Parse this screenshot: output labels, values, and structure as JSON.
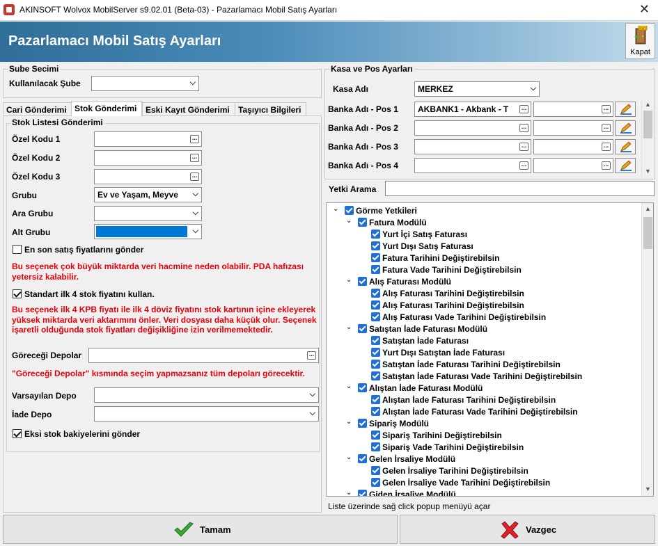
{
  "window": {
    "title": "AKINSOFT Wolvox MobilServer s9.02.01 (Beta-03) - Pazarlamacı Mobil Satış Ayarları",
    "close_glyph": "✕"
  },
  "banner": {
    "title": "Pazarlamacı Mobil Satış Ayarları",
    "exit_label": "Kapat",
    "exit_icon_text": "EXIT"
  },
  "sube": {
    "caption": "Sube Secimi",
    "label": "Kullanılacak Şube",
    "value": ""
  },
  "tabs": [
    {
      "label": "Cari Gönderimi",
      "active": false
    },
    {
      "label": "Stok Gönderimi",
      "active": true
    },
    {
      "label": "Eski Kayıt Gönderimi",
      "active": false
    },
    {
      "label": "Taşıyıcı Bilgileri",
      "active": false
    }
  ],
  "stok": {
    "caption": "Stok Listesi Gönderimi",
    "ozel_kodu_1": {
      "label": "Özel Kodu 1",
      "value": ""
    },
    "ozel_kodu_2": {
      "label": "Özel Kodu 2",
      "value": ""
    },
    "ozel_kodu_3": {
      "label": "Özel Kodu 3",
      "value": ""
    },
    "grubu": {
      "label": "Grubu",
      "value": "Ev ve Yaşam, Meyve"
    },
    "ara_grubu": {
      "label": "Ara Grubu",
      "value": ""
    },
    "alt_grubu": {
      "label": "Alt Grubu",
      "value": "",
      "selected_color": "#0078d7"
    },
    "chk_son_satis": {
      "label": "En son satış fiyatlarını gönder",
      "checked": false
    },
    "warn_1": "Bu seçenek çok büyük miktarda veri hacmine neden olabilir. PDA hafızası yetersiz kalabilir.",
    "chk_standart": {
      "label": "Standart ilk 4 stok fiyatını kullan.",
      "checked": true
    },
    "warn_2": "Bu seçenek ilk 4 KPB fiyatı ile ilk 4 döviz fiyatını stok kartının içine ekleyerek yüksek miktarda veri aktarımını önler. Veri dosyası daha küçük olur. Seçenek işaretli olduğunda stok fiyatları değişikliğine izin verilmemektedir.",
    "gorecegi_depolar": {
      "label": "Göreceği Depolar",
      "value": ""
    },
    "warn_3": "\"Göreceği Depolar\" kısmında seçim yapmazsanız tüm depoları görecektir.",
    "varsayilan_depo": {
      "label": "Varsayılan Depo",
      "value": ""
    },
    "iade_depo": {
      "label": "İade Depo",
      "value": ""
    },
    "chk_eksi_stok": {
      "label": "Eksi stok bakiyelerini gönder",
      "checked": true
    }
  },
  "kasa": {
    "caption": "Kasa ve Pos Ayarları",
    "kasa_label": "Kasa Adı",
    "kasa_value": "MERKEZ",
    "pos": [
      {
        "label": "Banka Adı - Pos 1",
        "value": "AKBANK1 - Akbank - T",
        "value2": ""
      },
      {
        "label": "Banka Adı - Pos 2",
        "value": "",
        "value2": ""
      },
      {
        "label": "Banka Adı - Pos 3",
        "value": "",
        "value2": ""
      },
      {
        "label": "Banka Adı - Pos 4",
        "value": "",
        "value2": ""
      }
    ]
  },
  "yetki": {
    "search_label": "Yetki Arama",
    "search_value": "",
    "tree": [
      {
        "level": 0,
        "expander": "minus",
        "label": "Görme Yetkileri"
      },
      {
        "level": 1,
        "expander": "minus",
        "label": "Fatura Modülü"
      },
      {
        "level": 2,
        "expander": "",
        "label": "Yurt İçi Satış Faturası"
      },
      {
        "level": 2,
        "expander": "",
        "label": "Yurt Dışı Satış Faturası"
      },
      {
        "level": 2,
        "expander": "",
        "label": "Fatura Tarihini Değiştirebilsin"
      },
      {
        "level": 2,
        "expander": "",
        "label": "Fatura Vade Tarihini Değiştirebilsin"
      },
      {
        "level": 1,
        "expander": "minus",
        "label": "Alış Faturası Modülü"
      },
      {
        "level": 2,
        "expander": "",
        "label": "Alış Faturası Tarihini Değiştirebilsin"
      },
      {
        "level": 2,
        "expander": "",
        "label": "Alış Faturası Tarihini Değiştirebilsin"
      },
      {
        "level": 2,
        "expander": "",
        "label": "Alış Faturası Vade Tarihini Değiştirebilsin"
      },
      {
        "level": 1,
        "expander": "minus",
        "label": "Satıştan İade Faturası Modülü"
      },
      {
        "level": 2,
        "expander": "",
        "label": "Satıştan İade Faturası"
      },
      {
        "level": 2,
        "expander": "",
        "label": "Yurt Dışı Satıştan İade Faturası"
      },
      {
        "level": 2,
        "expander": "",
        "label": "Satıştan İade Faturası Tarihini Değiştirebilsin"
      },
      {
        "level": 2,
        "expander": "",
        "label": "Satıştan İade Faturası Vade Tarihini Değiştirebilsin"
      },
      {
        "level": 1,
        "expander": "minus",
        "label": "Alıştan İade Faturası Modülü"
      },
      {
        "level": 2,
        "expander": "",
        "label": "Alıştan İade Faturası Tarihini Değiştirebilsin"
      },
      {
        "level": 2,
        "expander": "",
        "label": "Alıştan İade Faturası Vade Tarihini Değiştirebilsin"
      },
      {
        "level": 1,
        "expander": "minus",
        "label": "Sipariş Modülü"
      },
      {
        "level": 2,
        "expander": "",
        "label": "Sipariş Tarihini Değiştirebilsin"
      },
      {
        "level": 2,
        "expander": "",
        "label": "Sipariş Vade Tarihini Değiştirebilsin"
      },
      {
        "level": 1,
        "expander": "minus",
        "label": "Gelen İrsaliye Modülü"
      },
      {
        "level": 2,
        "expander": "",
        "label": "Gelen İrsaliye Tarihini Değiştirebilsin"
      },
      {
        "level": 2,
        "expander": "",
        "label": "Gelen İrsaliye Vade Tarihini Değiştirebilsin"
      },
      {
        "level": 1,
        "expander": "minus",
        "label": "Giden İrsaliye Modülü"
      }
    ],
    "status": "Liste üzerinde sağ click popup menüyü açar"
  },
  "buttons": {
    "ok_label": "Tamam",
    "cancel_label": "Vazgec"
  },
  "colors": {
    "warn": "#e8000b",
    "check_blue": "#1f6fd6",
    "ok_green": "#3aa935",
    "cancel_red": "#e0202a"
  },
  "icons": {
    "ellipsis": "...",
    "dropdown": "⌵",
    "expander_minus": "⌄",
    "scroll_up": "▲",
    "scroll_down": "▼"
  }
}
